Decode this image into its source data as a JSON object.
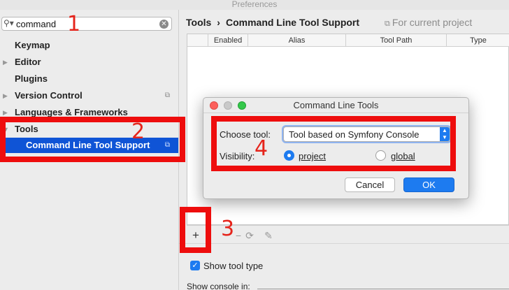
{
  "window": {
    "title": "Preferences"
  },
  "search": {
    "value": "command"
  },
  "tree": {
    "items": [
      {
        "label": "Keymap",
        "arrow": "",
        "cfg": ""
      },
      {
        "label": "Editor",
        "arrow": "▶",
        "cfg": ""
      },
      {
        "label": "Plugins",
        "arrow": "",
        "cfg": ""
      },
      {
        "label": "Version Control",
        "arrow": "▶",
        "cfg": "⧉"
      },
      {
        "label": "Languages & Frameworks",
        "arrow": "▶",
        "cfg": ""
      },
      {
        "label": "Tools",
        "arrow": "▼",
        "cfg": ""
      },
      {
        "label": "Command Line Tool Support",
        "arrow": "",
        "cfg": "⧉"
      }
    ]
  },
  "breadcrumb": {
    "parent": "Tools",
    "separator": "›",
    "current": "Command Line Tool Support"
  },
  "scope": {
    "icon": "⧉",
    "label": "For current project"
  },
  "table": {
    "columns": [
      "Enabled",
      "Alias",
      "Tool Path",
      "Type"
    ]
  },
  "toolbar": {
    "add": "+",
    "remove": "−",
    "refresh": "⟳",
    "edit": "✎"
  },
  "options": {
    "show_tool_type": "Show tool type",
    "show_console_in": "Show console in:"
  },
  "dialog": {
    "title": "Command Line Tools",
    "choose_tool_label": "Choose tool:",
    "choose_tool_value": "Tool based on Symfony Console",
    "visibility_label": "Visibility:",
    "radio_project": "project",
    "radio_global": "global",
    "cancel": "Cancel",
    "ok": "OK"
  },
  "annotations": {
    "n1": "1",
    "n2": "2",
    "n3": "3",
    "n4": "4"
  },
  "colors": {
    "accent": "#1d7bf0",
    "selection": "#0f54d6",
    "annotation_red": "#ee0d0d"
  }
}
